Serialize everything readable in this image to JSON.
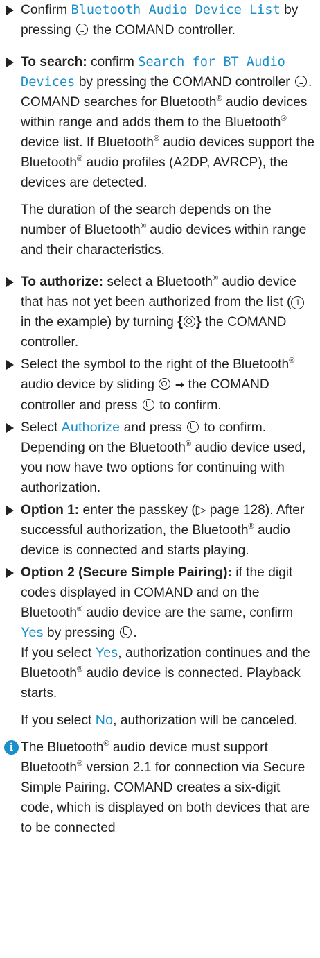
{
  "steps": [
    {
      "intro": "Confirm ",
      "cmd": "Bluetooth Audio Device List",
      "rest": " by pressing",
      "tail": " the COMAND controller."
    },
    {
      "lead": "To search:",
      "intro": " confirm ",
      "cmd": "Search for BT Audio Devices",
      "rest": " by pressing the COMAND controller",
      "tail": ".",
      "para1a": "COMAND searches for Bluetooth",
      "para1b": " audio devices within range and adds them to the Bluetooth",
      "para1c": " device list. If Bluetooth",
      "para1d": " audio devices support the Bluetooth",
      "para1e": " audio profiles (A2DP, AVRCP), the devices are detected.",
      "para2": "The duration of the search depends on the number of Bluetooth",
      "para2b": " audio devices within range and their characteristics."
    },
    {
      "lead": "To authorize:",
      "a": " select a Bluetooth",
      "b": " audio device that has not yet been authorized from the list (",
      "callout": "1",
      "c": " in the example) by turning ",
      "d": " the COMAND controller."
    },
    {
      "a": "Select the symbol to the right of the Bluetooth",
      "b": " audio device by sliding ",
      "c": " the COMAND controller and press ",
      "d": " to confirm."
    },
    {
      "a": "Select ",
      "cmd": "Authorize",
      "b": " and press ",
      "c": " to confirm. Depending on the Bluetooth",
      "d": " audio device used, you now have two options for continuing with authorization."
    },
    {
      "lead": "Option 1:",
      "a": " enter the passkey (",
      "ref": "▷ page 128",
      "b": "). After successful authorization, the Bluetooth",
      "c": " audio device is connected and starts playing."
    },
    {
      "lead": "Option 2 (Secure Simple Pairing):",
      "a": " if the digit codes displayed in COMAND and on the Bluetooth",
      "b": " audio device are the same, confirm ",
      "yes": "Yes",
      "c": " by pressing ",
      "d": ".",
      "p1a": "If you select ",
      "p1yes": "Yes",
      "p1b": ", authorization continues and the Bluetooth",
      "p1c": " audio device is connected. Playback starts.",
      "p2a": "If you select ",
      "p2no": "No",
      "p2b": ", authorization will be canceled."
    }
  ],
  "info": {
    "icon": "i",
    "a": "The Bluetooth",
    "b": " audio device must support Bluetooth",
    "c": " version 2.1 for connection via Secure Simple Pairing. COMAND creates a six-digit code, which is displayed on both devices that are to be connected"
  },
  "reg": "®",
  "symbols": {
    "turn_left": "{",
    "turn_right": "}",
    "slide_arrow": "➡"
  },
  "colors": {
    "accent": "#1a8fc9",
    "text": "#222222"
  }
}
